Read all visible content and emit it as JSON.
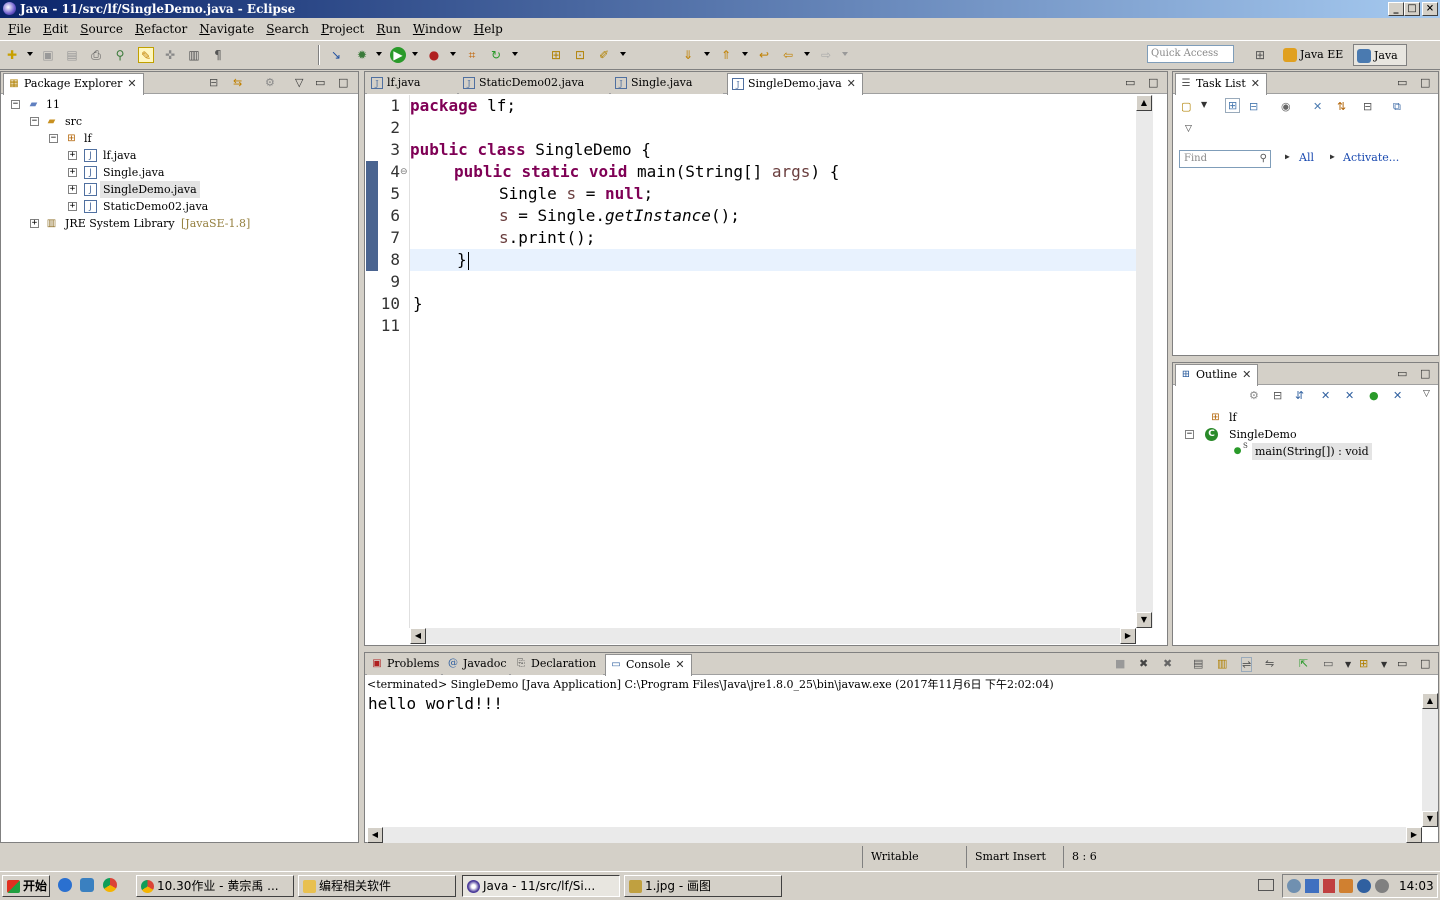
{
  "window": {
    "title": "Java - 11/src/lf/SingleDemo.java - Eclipse",
    "min": "_",
    "max": "□",
    "close": "×"
  },
  "menu": [
    "File",
    "Edit",
    "Source",
    "Refactor",
    "Navigate",
    "Search",
    "Project",
    "Run",
    "Window",
    "Help"
  ],
  "toolbar": {
    "quick_access_placeholder": "Quick Access",
    "perspectives": [
      "Java EE",
      "Java"
    ]
  },
  "package_explorer": {
    "tab_label": "Package Explorer",
    "tree": [
      {
        "label": "11",
        "icon": "project-icon"
      },
      {
        "label": "src",
        "icon": "source-folder-icon"
      },
      {
        "label": "lf",
        "icon": "package-icon"
      },
      {
        "label": "lf.java",
        "icon": "java-file-icon"
      },
      {
        "label": "Single.java",
        "icon": "java-file-icon"
      },
      {
        "label": "SingleDemo.java",
        "icon": "java-file-icon",
        "selected": true
      },
      {
        "label": "StaticDemo02.java",
        "icon": "java-file-icon"
      },
      {
        "label": "JRE System Library",
        "suffix": "[JavaSE-1.8]",
        "icon": "library-icon"
      }
    ]
  },
  "editor": {
    "tabs": [
      {
        "label": "lf.java"
      },
      {
        "label": "StaticDemo02.java"
      },
      {
        "label": "Single.java"
      },
      {
        "label": "SingleDemo.java",
        "active": true
      }
    ],
    "line_numbers": [
      "1",
      "2",
      "3",
      "4",
      "5",
      "6",
      "7",
      "8",
      "9",
      "10",
      "11"
    ],
    "code": {
      "l1_kw": "package",
      "l1_rest": " lf;",
      "l3_kw1": "public",
      "l3_kw2": "class",
      "l3_rest": " SingleDemo {",
      "l4_kw1": "public",
      "l4_kw2": "static",
      "l4_kw3": "void",
      "l4_a": " main(String[] ",
      "l4_var": "args",
      "l4_b": ") {",
      "l5_a": "Single ",
      "l5_var": "s",
      "l5_b": " = ",
      "l5_kw": "null",
      "l5_c": ";",
      "l6_var": "s",
      "l6_a": " = Single.",
      "l6_it": "getInstance",
      "l6_b": "();",
      "l7_var": "s",
      "l7_a": ".print();",
      "l8": "}",
      "l10": "}"
    },
    "cursor_line": 8
  },
  "task_list": {
    "tab_label": "Task List",
    "find_placeholder": "Find",
    "all_label": "All",
    "activate_label": "Activate..."
  },
  "outline": {
    "tab_label": "Outline",
    "items": [
      {
        "label": "lf",
        "icon": "package-icon"
      },
      {
        "label": "SingleDemo",
        "icon": "class-icon"
      },
      {
        "label": "main(String[]) : void",
        "icon": "method-icon",
        "selected": true
      }
    ]
  },
  "bottom_tabs": [
    {
      "label": "Problems"
    },
    {
      "label": "Javadoc"
    },
    {
      "label": "Declaration"
    },
    {
      "label": "Console",
      "active": true
    }
  ],
  "console": {
    "header": "<terminated> SingleDemo [Java Application] C:\\Program Files\\Java\\jre1.8.0_25\\bin\\javaw.exe (2017年11月6日 下午2:02:04)",
    "output": "hello world!!!"
  },
  "status": {
    "writable": "Writable",
    "insert_mode": "Smart Insert",
    "position": "8 : 6"
  },
  "taskbar": {
    "start_label": "开始",
    "buttons": [
      {
        "label": "10.30作业 - 黄宗禹 ..."
      },
      {
        "label": "编程相关软件"
      },
      {
        "label": "Java - 11/src/lf/Si...",
        "active": true
      },
      {
        "label": "1.jpg - 画图"
      }
    ],
    "clock": "14:03"
  }
}
